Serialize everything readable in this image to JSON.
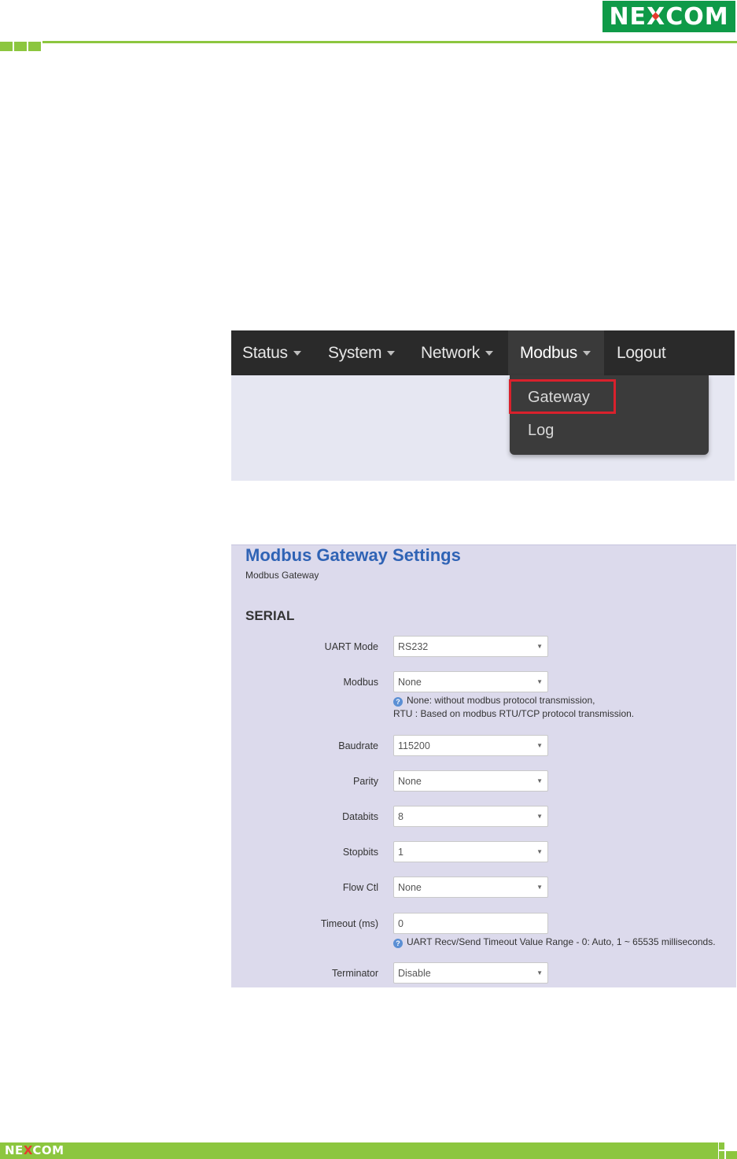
{
  "brand": {
    "logo_text": "NEXCOM",
    "colors": {
      "green": "#8cc63f",
      "logo_green": "#0f9a48",
      "accent_red": "#d9212c",
      "title_blue": "#2f63b5"
    }
  },
  "nav": {
    "items": [
      {
        "label": "Status",
        "caret": true
      },
      {
        "label": "System",
        "caret": true
      },
      {
        "label": "Network",
        "caret": true
      },
      {
        "label": "Modbus",
        "caret": true,
        "active": true
      },
      {
        "label": "Logout",
        "caret": false
      }
    ],
    "dropdown": [
      "Gateway",
      "Log"
    ]
  },
  "settings": {
    "title": "Modbus Gateway Settings",
    "subtitle": "Modbus Gateway",
    "section": "SERIAL",
    "fields": {
      "uart_mode": {
        "label": "UART Mode",
        "value": "RS232"
      },
      "modbus": {
        "label": "Modbus",
        "value": "None",
        "help1": "None: without modbus protocol transmission,",
        "help2": "RTU : Based on modbus RTU/TCP protocol transmission."
      },
      "baudrate": {
        "label": "Baudrate",
        "value": "115200"
      },
      "parity": {
        "label": "Parity",
        "value": "None"
      },
      "databits": {
        "label": "Databits",
        "value": "8"
      },
      "stopbits": {
        "label": "Stopbits",
        "value": "1"
      },
      "flow_ctl": {
        "label": "Flow Ctl",
        "value": "None"
      },
      "timeout": {
        "label": "Timeout (ms)",
        "value": "0",
        "help": "UART Recv/Send Timeout Value Range - 0: Auto, 1 ~ 65535 milliseconds."
      },
      "terminator": {
        "label": "Terminator",
        "value": "Disable"
      }
    }
  },
  "footer": {
    "logo_text": "NEXCOM"
  }
}
